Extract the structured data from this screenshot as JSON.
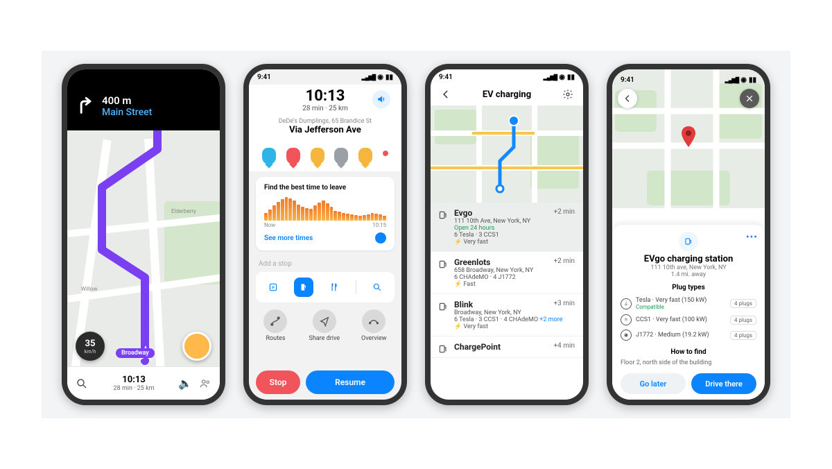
{
  "status_time": "9:41",
  "phone1": {
    "distance": "400 m",
    "street": "Main Street",
    "route_badge": "Broadway",
    "speed_value": "35",
    "speed_unit": "km/h",
    "eta_time": "10:13",
    "eta_sub": "28 min · 25 km",
    "map_labels": {
      "elderberry": "Elderberry",
      "willow": "Willow"
    }
  },
  "phone2": {
    "arrive_time": "10:13",
    "arrive_sub": "28 min · 25 km",
    "destination": "DeDe's Dumplings, 65 Brandice St",
    "via": "Via Jefferson Ave",
    "best_time_title": "Find the best time to leave",
    "range_start": "Now",
    "range_end": "10:15",
    "see_more": "See more times",
    "add_stop_placeholder": "Add a stop",
    "actions": {
      "routes": "Routes",
      "share": "Share drive",
      "overview": "Overview"
    },
    "stop_label": "Stop",
    "resume_label": "Resume"
  },
  "phone3": {
    "title": "EV charging",
    "items": [
      {
        "name": "Evgo",
        "addr": "111 10th Ave, New York, NY",
        "open": "Open 24 hours",
        "plugs": "6 Tesla · 3 CCS1",
        "speed": "Very fast",
        "eta": "+2 min"
      },
      {
        "name": "Greenlots",
        "addr": "658 Broadway, New York, NY",
        "plugs": "6 CHAdeMO · 4 J1772",
        "speed": "Fast",
        "eta": "+2 min"
      },
      {
        "name": "Blink",
        "addr": "Broadway, New York, NY",
        "plugs": "6 Tesla · 3 CCS1 · 4 CHAdeMO",
        "plugs_more": "+2 more",
        "speed": "Very fast",
        "eta": "+3 min"
      },
      {
        "name": "ChargePoint",
        "eta": "+4 min"
      }
    ]
  },
  "phone4": {
    "station_name": "EVgo charging station",
    "station_addr": "111 10th ave, New York, NY",
    "station_dist": "1.4 mi. away",
    "plug_section": "Plug types",
    "plugs": [
      {
        "name": "Tesla · Very fast (150 kW)",
        "compat": "Compatible",
        "count": "4 plugs"
      },
      {
        "name": "CCS1 · Very fast (100 kW)",
        "count": "4 plugs"
      },
      {
        "name": "J1772 · Medium (19.2 kW)",
        "count": "4 plugs"
      }
    ],
    "find_section": "How to find",
    "find_text": "Floor 2, north side of the building",
    "go_later": "Go later",
    "drive_there": "Drive there"
  }
}
